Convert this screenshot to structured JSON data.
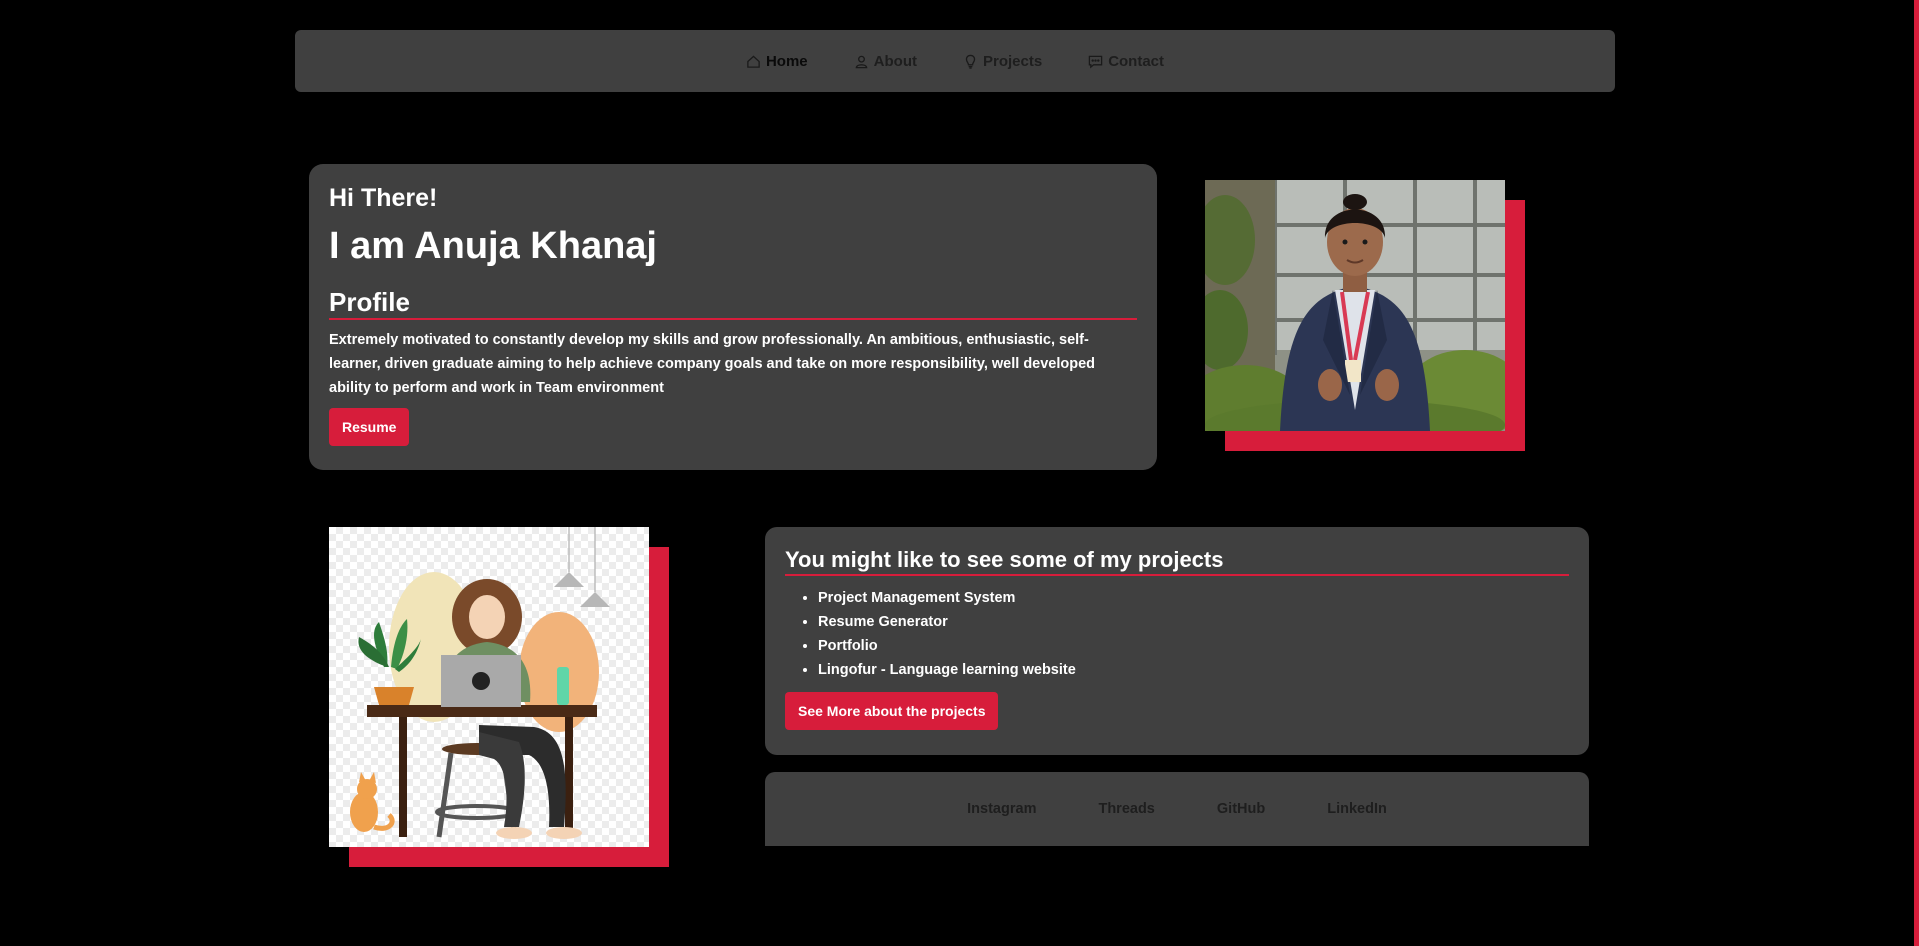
{
  "nav": {
    "items": [
      {
        "label": "Home",
        "icon": "home-icon",
        "active": true
      },
      {
        "label": "About",
        "icon": "user-icon",
        "active": false
      },
      {
        "label": "Projects",
        "icon": "lightbulb-icon",
        "active": false
      },
      {
        "label": "Contact",
        "icon": "chat-icon",
        "active": false
      }
    ]
  },
  "hero": {
    "greeting": "Hi There!",
    "name": "I am Anuja Khanaj",
    "profile_heading": "Profile",
    "profile_text": "Extremely motivated to constantly develop my skills and grow professionally. An ambitious, enthusiastic, self-learner, driven graduate aiming to help achieve company goals and take on more responsibility, well developed ability to perform and work in Team environment",
    "resume_label": "Resume"
  },
  "projects": {
    "heading": "You might like to see some of my projects",
    "items": [
      "Project Management System",
      "Resume Generator",
      "Portfolio",
      "Lingofur - Language learning website"
    ],
    "button_label": "See More about the projects"
  },
  "social": {
    "links": [
      "Instagram",
      "Threads",
      "GitHub",
      "LinkedIn"
    ]
  },
  "colors": {
    "background": "#000000",
    "card": "#404040",
    "accent": "#d71d3b",
    "muted_link": "#1e1e1e"
  }
}
